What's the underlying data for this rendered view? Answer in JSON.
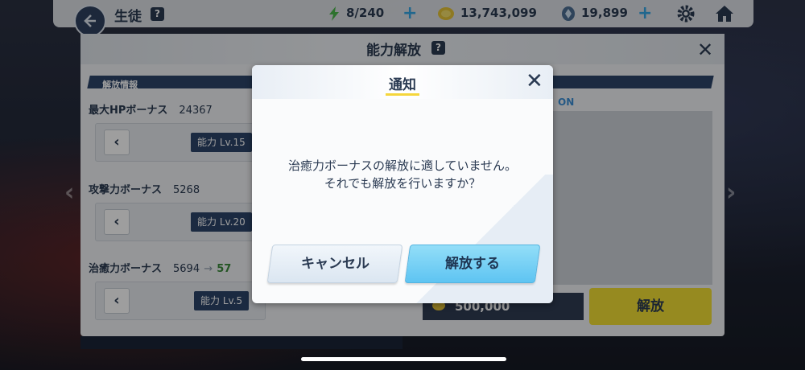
{
  "topbar": {
    "title": "生徒",
    "help": "?",
    "stamina": "8/240",
    "credits": "13,743,099",
    "gems": "19,899"
  },
  "panel": {
    "title": "能力解放",
    "help": "?",
    "section_label": "解放情報",
    "right_label": "ON",
    "items": [
      {
        "label": "最大HPボーナス",
        "value": "24367",
        "level": "能力 Lv.15"
      },
      {
        "label": "攻撃力ボーナス",
        "value": "5268",
        "level": "能力 Lv.20"
      },
      {
        "label": "治癒力ボーナス",
        "value": "5694",
        "arrow": "→",
        "next": "57",
        "level": "能力 Lv.5"
      }
    ],
    "cost": "500,000",
    "release_label": "解放"
  },
  "dialog": {
    "title": "通知",
    "line1": "治癒力ボーナスの解放に適していません。",
    "line2": "それでも解放を行いますか？",
    "cancel_label": "キャンセル",
    "ok_label": "解放する"
  },
  "colors": {
    "accent_blue": "#5ec4f2",
    "accent_yellow": "#f2df35",
    "navy": "#2d4569"
  }
}
